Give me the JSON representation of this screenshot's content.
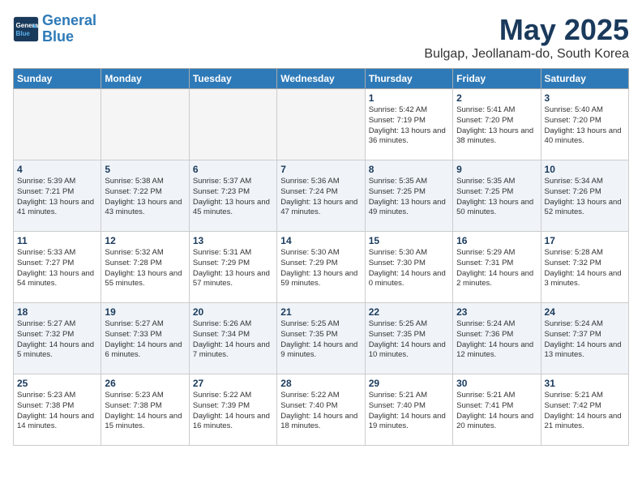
{
  "header": {
    "logo_line1": "General",
    "logo_line2": "Blue",
    "month": "May 2025",
    "location": "Bulgap, Jeollanam-do, South Korea"
  },
  "weekdays": [
    "Sunday",
    "Monday",
    "Tuesday",
    "Wednesday",
    "Thursday",
    "Friday",
    "Saturday"
  ],
  "weeks": [
    [
      {
        "day": "",
        "empty": true
      },
      {
        "day": "",
        "empty": true
      },
      {
        "day": "",
        "empty": true
      },
      {
        "day": "",
        "empty": true
      },
      {
        "day": "1",
        "sunrise": "5:42 AM",
        "sunset": "7:19 PM",
        "daylight": "13 hours and 36 minutes."
      },
      {
        "day": "2",
        "sunrise": "5:41 AM",
        "sunset": "7:20 PM",
        "daylight": "13 hours and 38 minutes."
      },
      {
        "day": "3",
        "sunrise": "5:40 AM",
        "sunset": "7:20 PM",
        "daylight": "13 hours and 40 minutes."
      }
    ],
    [
      {
        "day": "4",
        "sunrise": "5:39 AM",
        "sunset": "7:21 PM",
        "daylight": "13 hours and 41 minutes."
      },
      {
        "day": "5",
        "sunrise": "5:38 AM",
        "sunset": "7:22 PM",
        "daylight": "13 hours and 43 minutes."
      },
      {
        "day": "6",
        "sunrise": "5:37 AM",
        "sunset": "7:23 PM",
        "daylight": "13 hours and 45 minutes."
      },
      {
        "day": "7",
        "sunrise": "5:36 AM",
        "sunset": "7:24 PM",
        "daylight": "13 hours and 47 minutes."
      },
      {
        "day": "8",
        "sunrise": "5:35 AM",
        "sunset": "7:25 PM",
        "daylight": "13 hours and 49 minutes."
      },
      {
        "day": "9",
        "sunrise": "5:35 AM",
        "sunset": "7:25 PM",
        "daylight": "13 hours and 50 minutes."
      },
      {
        "day": "10",
        "sunrise": "5:34 AM",
        "sunset": "7:26 PM",
        "daylight": "13 hours and 52 minutes."
      }
    ],
    [
      {
        "day": "11",
        "sunrise": "5:33 AM",
        "sunset": "7:27 PM",
        "daylight": "13 hours and 54 minutes."
      },
      {
        "day": "12",
        "sunrise": "5:32 AM",
        "sunset": "7:28 PM",
        "daylight": "13 hours and 55 minutes."
      },
      {
        "day": "13",
        "sunrise": "5:31 AM",
        "sunset": "7:29 PM",
        "daylight": "13 hours and 57 minutes."
      },
      {
        "day": "14",
        "sunrise": "5:30 AM",
        "sunset": "7:29 PM",
        "daylight": "13 hours and 59 minutes."
      },
      {
        "day": "15",
        "sunrise": "5:30 AM",
        "sunset": "7:30 PM",
        "daylight": "14 hours and 0 minutes."
      },
      {
        "day": "16",
        "sunrise": "5:29 AM",
        "sunset": "7:31 PM",
        "daylight": "14 hours and 2 minutes."
      },
      {
        "day": "17",
        "sunrise": "5:28 AM",
        "sunset": "7:32 PM",
        "daylight": "14 hours and 3 minutes."
      }
    ],
    [
      {
        "day": "18",
        "sunrise": "5:27 AM",
        "sunset": "7:32 PM",
        "daylight": "14 hours and 5 minutes."
      },
      {
        "day": "19",
        "sunrise": "5:27 AM",
        "sunset": "7:33 PM",
        "daylight": "14 hours and 6 minutes."
      },
      {
        "day": "20",
        "sunrise": "5:26 AM",
        "sunset": "7:34 PM",
        "daylight": "14 hours and 7 minutes."
      },
      {
        "day": "21",
        "sunrise": "5:25 AM",
        "sunset": "7:35 PM",
        "daylight": "14 hours and 9 minutes."
      },
      {
        "day": "22",
        "sunrise": "5:25 AM",
        "sunset": "7:35 PM",
        "daylight": "14 hours and 10 minutes."
      },
      {
        "day": "23",
        "sunrise": "5:24 AM",
        "sunset": "7:36 PM",
        "daylight": "14 hours and 12 minutes."
      },
      {
        "day": "24",
        "sunrise": "5:24 AM",
        "sunset": "7:37 PM",
        "daylight": "14 hours and 13 minutes."
      }
    ],
    [
      {
        "day": "25",
        "sunrise": "5:23 AM",
        "sunset": "7:38 PM",
        "daylight": "14 hours and 14 minutes."
      },
      {
        "day": "26",
        "sunrise": "5:23 AM",
        "sunset": "7:38 PM",
        "daylight": "14 hours and 15 minutes."
      },
      {
        "day": "27",
        "sunrise": "5:22 AM",
        "sunset": "7:39 PM",
        "daylight": "14 hours and 16 minutes."
      },
      {
        "day": "28",
        "sunrise": "5:22 AM",
        "sunset": "7:40 PM",
        "daylight": "14 hours and 18 minutes."
      },
      {
        "day": "29",
        "sunrise": "5:21 AM",
        "sunset": "7:40 PM",
        "daylight": "14 hours and 19 minutes."
      },
      {
        "day": "30",
        "sunrise": "5:21 AM",
        "sunset": "7:41 PM",
        "daylight": "14 hours and 20 minutes."
      },
      {
        "day": "31",
        "sunrise": "5:21 AM",
        "sunset": "7:42 PM",
        "daylight": "14 hours and 21 minutes."
      }
    ]
  ]
}
